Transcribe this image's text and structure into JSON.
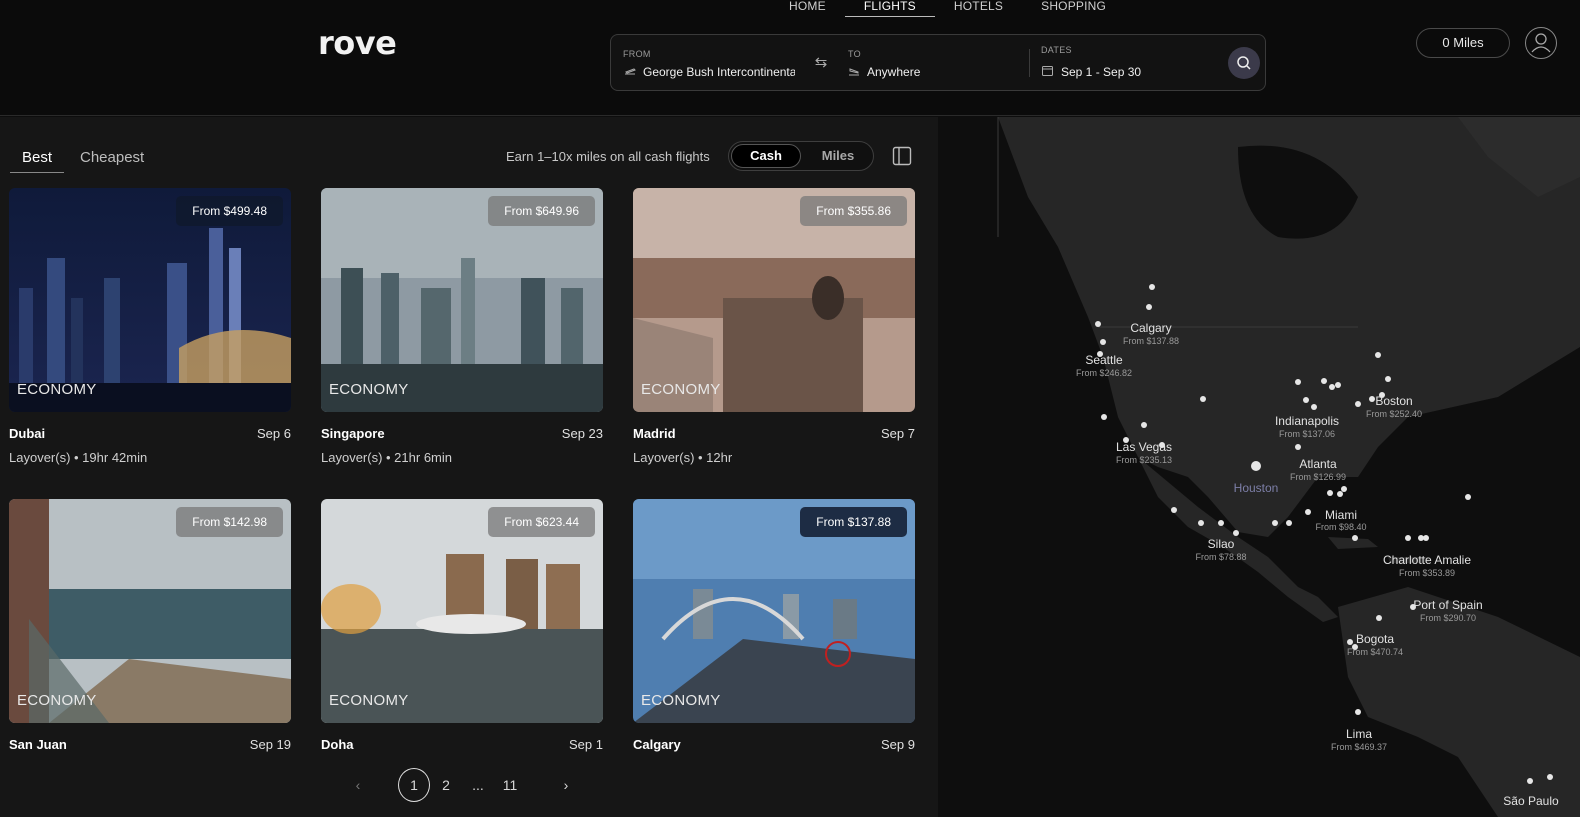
{
  "brand": "rove",
  "nav": [
    "HOME",
    "FLIGHTS",
    "HOTELS",
    "SHOPPING"
  ],
  "search": {
    "from_label": "FROM",
    "from_value": "George Bush Intercontinental",
    "to_label": "TO",
    "to_value": "Anywhere",
    "dates_label": "DATES",
    "dates_value": "Sep 1 - Sep 30"
  },
  "account": {
    "miles": "0 Miles"
  },
  "sort": {
    "best": "Best",
    "cheapest": "Cheapest"
  },
  "earn_text": "Earn 1–10x miles on all cash flights",
  "toggle": {
    "cash": "Cash",
    "miles": "Miles"
  },
  "cards": [
    {
      "city": "Dubai",
      "date": "Sep 6",
      "price": "From $499.48",
      "cabin": "ECONOMY",
      "layover": "Layover(s) • 19hr 42min"
    },
    {
      "city": "Singapore",
      "date": "Sep 23",
      "price": "From $649.96",
      "cabin": "ECONOMY",
      "layover": "Layover(s) • 21hr 6min"
    },
    {
      "city": "Madrid",
      "date": "Sep 7",
      "price": "From $355.86",
      "cabin": "ECONOMY",
      "layover": "Layover(s) • 12hr"
    },
    {
      "city": "San Juan",
      "date": "Sep 19",
      "price": "From $142.98",
      "cabin": "ECONOMY",
      "layover": ""
    },
    {
      "city": "Doha",
      "date": "Sep 1",
      "price": "From $623.44",
      "cabin": "ECONOMY",
      "layover": ""
    },
    {
      "city": "Calgary",
      "date": "Sep 9",
      "price": "From $137.88",
      "cabin": "ECONOMY",
      "layover": ""
    }
  ],
  "pagination": {
    "prev": "‹",
    "current": "1",
    "next_page": "2",
    "ellipsis": "...",
    "last": "11",
    "next": "›"
  },
  "map_labels": [
    {
      "name": "Calgary",
      "price": "From $137.88"
    },
    {
      "name": "Seattle",
      "price": "From $246.82"
    },
    {
      "name": "Boston",
      "price": "From $252.40"
    },
    {
      "name": "Indianapolis",
      "price": "From $137.06"
    },
    {
      "name": "Las Vegas",
      "price": "From $235.13"
    },
    {
      "name": "Atlanta",
      "price": "From $126.99"
    },
    {
      "name": "Houston",
      "price": ""
    },
    {
      "name": "Miami",
      "price": "From $98.40"
    },
    {
      "name": "Silao",
      "price": "From $78.88"
    },
    {
      "name": "Charlotte Amalie",
      "price": "From $353.89"
    },
    {
      "name": "Port of Spain",
      "price": "From $290.70"
    },
    {
      "name": "Bogota",
      "price": "From $470.74"
    },
    {
      "name": "Lima",
      "price": "From $469.37"
    },
    {
      "name": "São Paulo",
      "price": ""
    }
  ]
}
